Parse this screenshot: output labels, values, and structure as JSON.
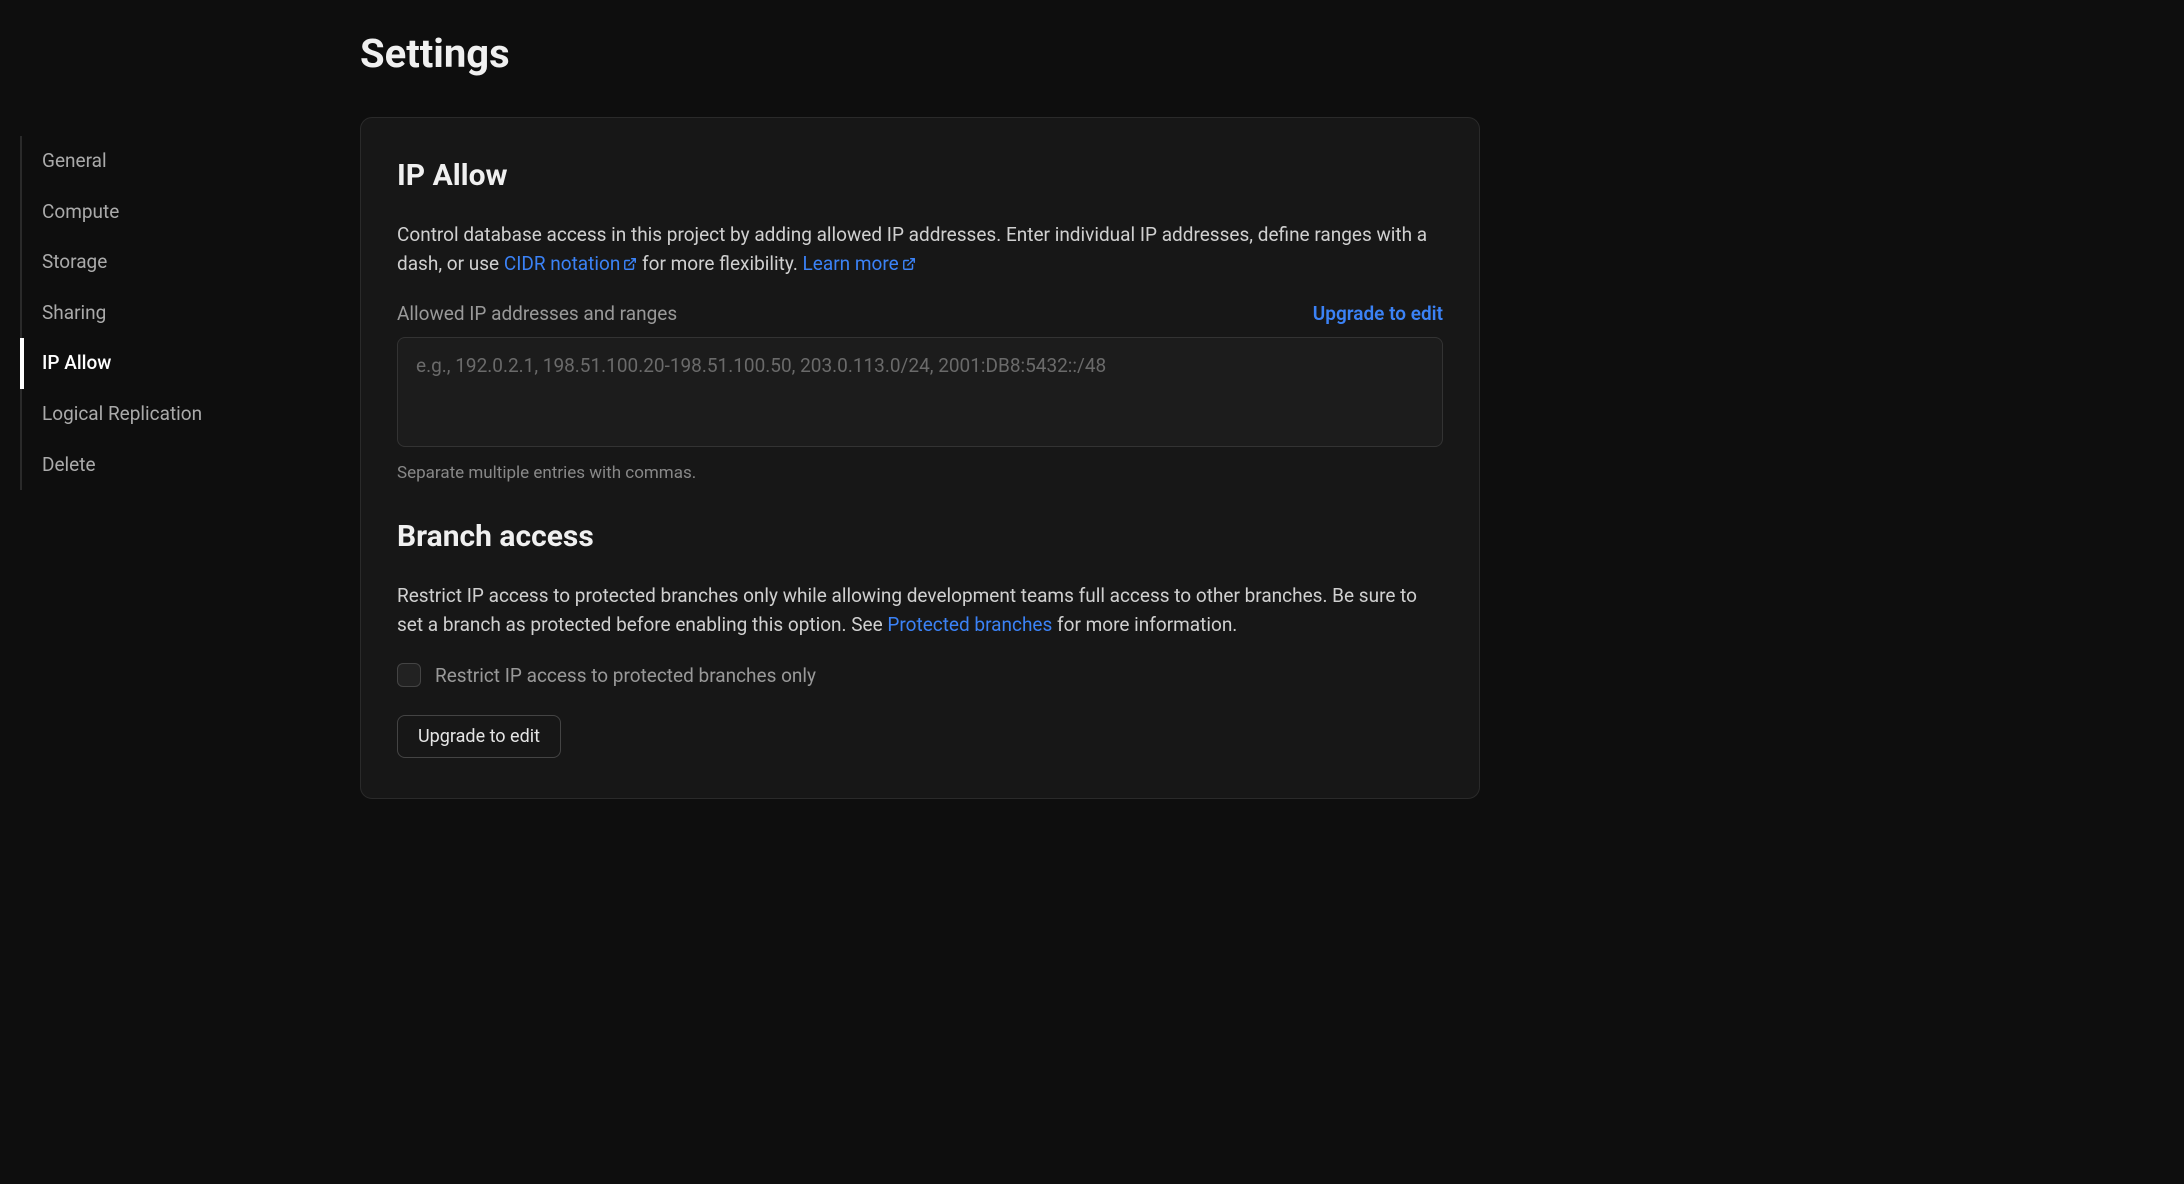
{
  "page": {
    "title": "Settings"
  },
  "sidebar": {
    "items": [
      {
        "label": "General",
        "active": false
      },
      {
        "label": "Compute",
        "active": false
      },
      {
        "label": "Storage",
        "active": false
      },
      {
        "label": "Sharing",
        "active": false
      },
      {
        "label": "IP Allow",
        "active": true
      },
      {
        "label": "Logical Replication",
        "active": false
      },
      {
        "label": "Delete",
        "active": false
      }
    ]
  },
  "ip_allow": {
    "title": "IP Allow",
    "description_prefix": "Control database access in this project by adding allowed IP addresses. Enter individual IP addresses, define ranges with a dash, or use ",
    "cidr_link": "CIDR notation",
    "description_middle": " for more flexibility. ",
    "learn_more": "Learn more",
    "field_label": "Allowed IP addresses and ranges",
    "upgrade_link": "Upgrade to edit",
    "placeholder": "e.g., 192.0.2.1, 198.51.100.20-198.51.100.50, 203.0.113.0/24, 2001:DB8:5432::/48",
    "help_text": "Separate multiple entries with commas."
  },
  "branch_access": {
    "title": "Branch access",
    "description_prefix": "Restrict IP access to protected branches only while allowing development teams full access to other branches. Be sure to set a branch as protected before enabling this option. See ",
    "protected_link": "Protected branches",
    "description_suffix": " for more information.",
    "checkbox_label": "Restrict IP access to protected branches only",
    "upgrade_button": "Upgrade to edit"
  }
}
